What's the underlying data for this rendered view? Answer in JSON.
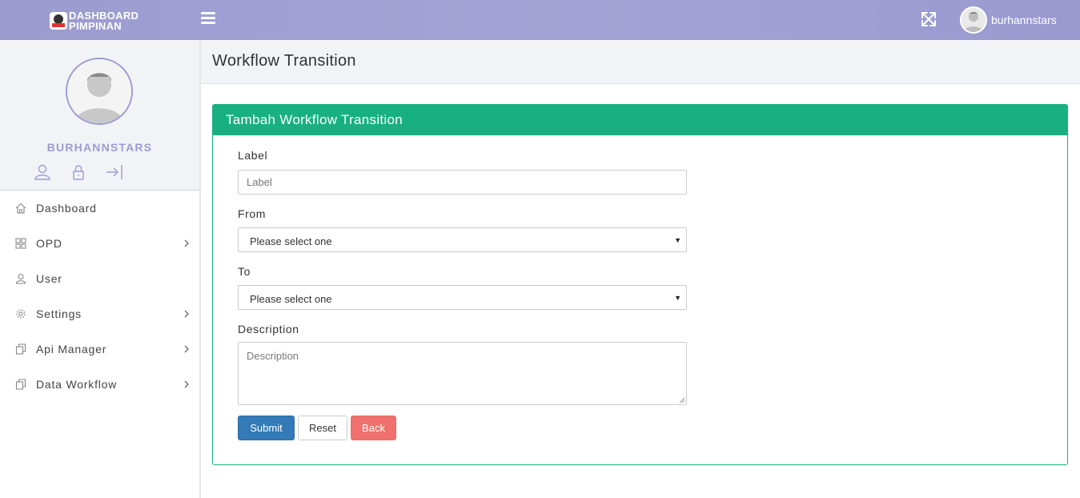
{
  "topbar": {
    "brand_line1": "DASHBOARD",
    "brand_line2": "PIMPINAN",
    "username": "burhannstars",
    "colors": {
      "bar": "#9f9fd3"
    }
  },
  "sidebar": {
    "profile_name": "BURHANNSTARS",
    "profile_icons": [
      "user-icon",
      "lock-icon",
      "logout-icon"
    ],
    "items": [
      {
        "label": "Dashboard",
        "icon": "home-icon",
        "has_submenu": false
      },
      {
        "label": "OPD",
        "icon": "grid-icon",
        "has_submenu": true
      },
      {
        "label": "User",
        "icon": "user-icon",
        "has_submenu": false
      },
      {
        "label": "Settings",
        "icon": "gear-icon",
        "has_submenu": true
      },
      {
        "label": "Api Manager",
        "icon": "copy-icon",
        "has_submenu": true
      },
      {
        "label": "Data Workflow",
        "icon": "copy-icon",
        "has_submenu": true
      }
    ]
  },
  "page": {
    "title": "Workflow Transition"
  },
  "panel": {
    "heading": "Tambah Workflow Transition",
    "accent_color": "#18b07e",
    "fields": {
      "label": {
        "label": "Label",
        "placeholder": "Label",
        "value": ""
      },
      "from": {
        "label": "From",
        "selected": "Please select one"
      },
      "to": {
        "label": "To",
        "selected": "Please select one"
      },
      "description": {
        "label": "Description",
        "placeholder": "Description",
        "value": ""
      }
    },
    "buttons": {
      "submit": "Submit",
      "reset": "Reset",
      "back": "Back"
    }
  }
}
